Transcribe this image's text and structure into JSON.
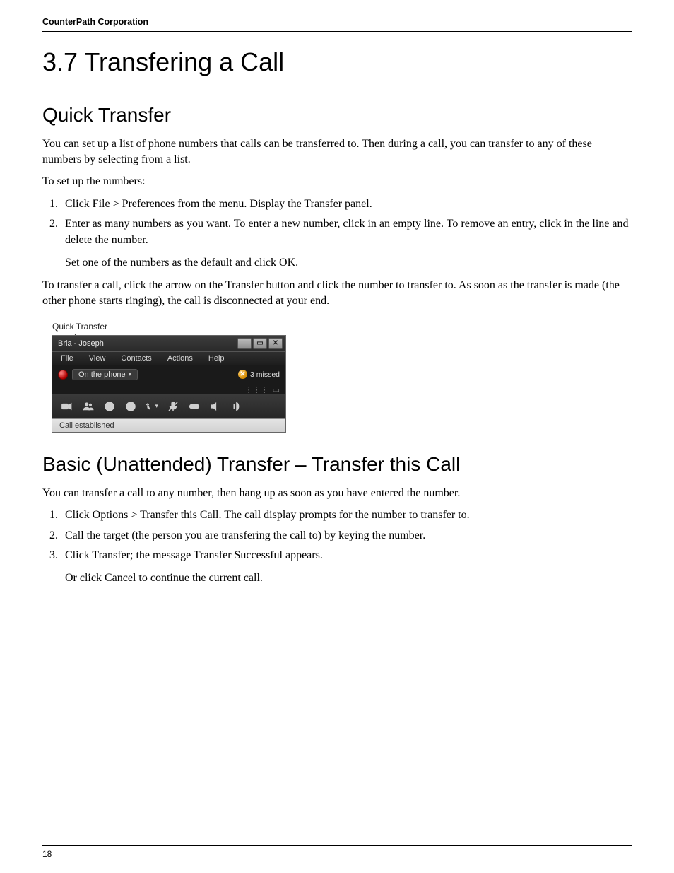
{
  "header": {
    "running_head": "CounterPath Corporation"
  },
  "title": "3.7 Transfering a Call",
  "section1": {
    "heading": "Quick Transfer",
    "p1": "You can set up a list of phone numbers that calls can be transferred to. Then during a call, you can transfer to any of these numbers by selecting from a list.",
    "p2": "To set up the numbers:",
    "steps": [
      "Click File > Preferences from the menu. Display the Transfer panel.",
      "Enter as many numbers as you want. To enter a new number, click in an empty line. To remove an entry, click in the line and delete the number."
    ],
    "step2_sub": "Set one of the numbers as the default and click OK.",
    "p3": "To transfer a call, click the arrow on the Transfer button and click the number to transfer to. As soon as the transfer is made (the other phone starts ringing), the call is disconnected at your end."
  },
  "callout": "Quick Transfer",
  "app": {
    "title": "Bria - Joseph",
    "menu": [
      "File",
      "View",
      "Contacts",
      "Actions",
      "Help"
    ],
    "status_text": "On the phone",
    "missed_count": "3 missed",
    "call_status": "Call established"
  },
  "section2": {
    "heading": "Basic (Unattended) Transfer – Transfer this Call",
    "p1": "You can transfer a call to any number, then hang up as soon as you have entered the number.",
    "steps": [
      "Click Options > Transfer this Call. The call display prompts for the number to transfer to.",
      "Call the target (the person you are transfering the call to) by keying the number.",
      "Click Transfer; the message Transfer Successful appears."
    ],
    "step3_sub": "Or click Cancel to continue the current call."
  },
  "footer": {
    "page": "18"
  }
}
